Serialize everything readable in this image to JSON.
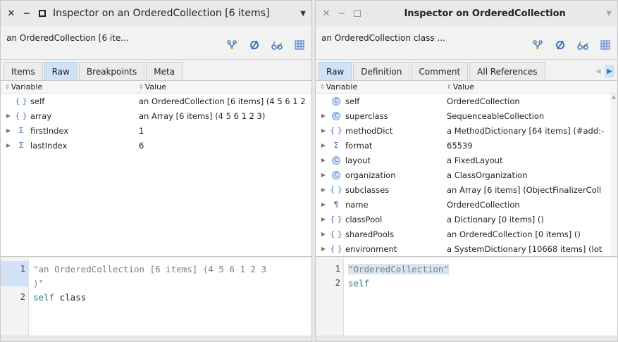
{
  "left": {
    "title": "Inspector on an OrderedCollection [6 items]",
    "subtitle": "an OrderedCollection [6 ite...",
    "tabs": [
      "Items",
      "Raw",
      "Breakpoints",
      "Meta"
    ],
    "active_tab": "Raw",
    "columns": {
      "variable": "Variable",
      "value": "Value"
    },
    "rows": [
      {
        "glyph": "{ }",
        "name": "self",
        "value": "an OrderedCollection [6 items] (4 5 6 1 2",
        "expand": false
      },
      {
        "glyph": "{ }",
        "name": "array",
        "value": "an Array [6 items] (4 5 6 1 2 3)",
        "expand": true
      },
      {
        "glyph": "Σ",
        "name": "firstIndex",
        "value": "1",
        "expand": true
      },
      {
        "glyph": "Σ",
        "name": "lastIndex",
        "value": "6",
        "expand": true
      }
    ],
    "editor": {
      "line1_no": "1",
      "line1a": "\"an OrderedCollection [6 items] (4 5 6 1 2 3",
      "line1b": ")\"",
      "line2_no": "2",
      "line2_self": "self",
      "line2_msg": " class"
    }
  },
  "right": {
    "title": "Inspector on OrderedCollection",
    "subtitle": "an OrderedCollection class ...",
    "tabs": [
      "Raw",
      "Definition",
      "Comment",
      "All References"
    ],
    "active_tab": "Raw",
    "columns": {
      "variable": "Variable",
      "value": "Value"
    },
    "rows": [
      {
        "glyph": "C",
        "name": "self",
        "value": "OrderedCollection",
        "expand": false
      },
      {
        "glyph": "C",
        "name": "superclass",
        "value": "SequenceableCollection",
        "expand": true
      },
      {
        "glyph": "{ }",
        "name": "methodDict",
        "value": "a MethodDictionary [64 items] (#add:-",
        "expand": true
      },
      {
        "glyph": "Σ",
        "name": "format",
        "value": "65539",
        "expand": true
      },
      {
        "glyph": "C",
        "name": "layout",
        "value": "a FixedLayout",
        "expand": true
      },
      {
        "glyph": "C",
        "name": "organization",
        "value": "a ClassOrganization",
        "expand": true
      },
      {
        "glyph": "{ }",
        "name": "subclasses",
        "value": "an Array [6 items] (ObjectFinalizerColl",
        "expand": true
      },
      {
        "glyph": "¶",
        "name": "name",
        "value": "OrderedCollection",
        "expand": true
      },
      {
        "glyph": "{ }",
        "name": "classPool",
        "value": "a Dictionary [0 items] ()",
        "expand": true
      },
      {
        "glyph": "{ }",
        "name": "sharedPools",
        "value": "an OrderedCollection [0 items] ()",
        "expand": true
      },
      {
        "glyph": "{ }",
        "name": "environment",
        "value": "a SystemDictionary [10668 items] (lot",
        "expand": true
      }
    ],
    "editor": {
      "line1_no": "1",
      "line1": "\"OrderedCollection\"",
      "line2_no": "2",
      "line2": "self"
    }
  },
  "icons": [
    "close-icon",
    "minimize-icon",
    "maximize-icon",
    "window-menu-icon",
    "browse-icon",
    "refresh-icon",
    "glasses-icon",
    "table-icon"
  ],
  "colors": {
    "active_tab": "#cfe2f8",
    "glyph": "#4a72b2",
    "code_identifier": "#1f7a7a"
  }
}
